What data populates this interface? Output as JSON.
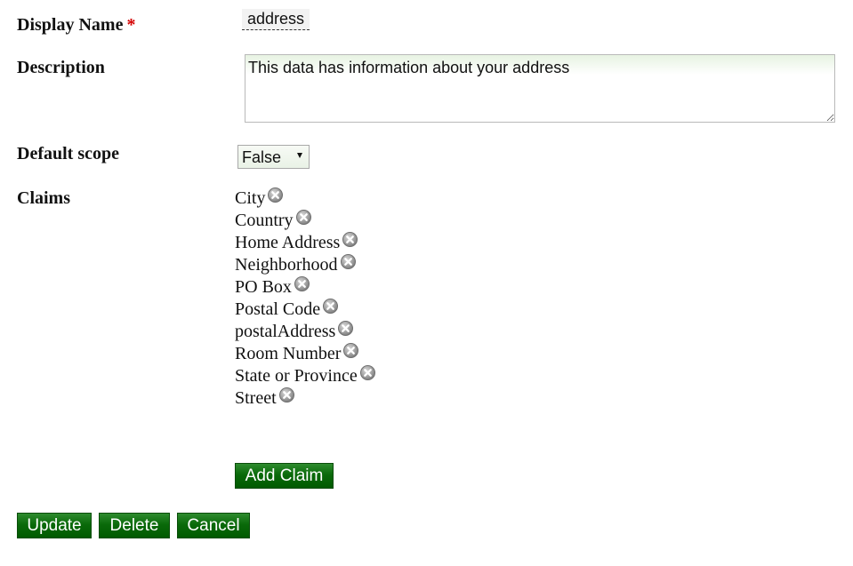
{
  "form": {
    "display_name_label": "Display Name",
    "required_marker": "*",
    "display_name_value": "address",
    "description_label": "Description",
    "description_value": "This data has information about your address",
    "default_scope_label": "Default scope",
    "default_scope_value": "False",
    "claims_label": "Claims"
  },
  "claims": [
    "City",
    "Country",
    "Home Address",
    "Neighborhood",
    "PO Box",
    "Postal Code",
    "postalAddress",
    "Room Number",
    "State or Province",
    "Street"
  ],
  "buttons": {
    "add_claim": "Add Claim",
    "update": "Update",
    "delete": "Delete",
    "cancel": "Cancel"
  },
  "icons": {
    "remove_claim": "remove-circle-icon",
    "dropdown": "chevron-down-icon"
  },
  "colors": {
    "button_green": "#0a6a0a",
    "required_red": "#d40000"
  }
}
